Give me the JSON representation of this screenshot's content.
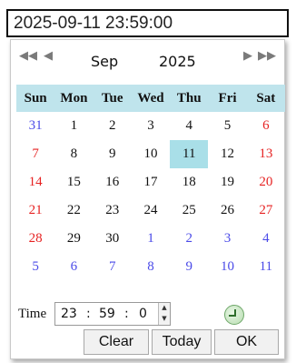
{
  "input": {
    "value": "2025-09-11 23:59:00"
  },
  "nav": {
    "prev_year_icon": "double-left-arrow",
    "prev_month_icon": "left-arrow",
    "next_month_icon": "right-arrow",
    "next_year_icon": "double-right-arrow",
    "month": "Sep",
    "year": "2025"
  },
  "calendar": {
    "weekdays": [
      "Sun",
      "Mon",
      "Tue",
      "Wed",
      "Thu",
      "Fri",
      "Sat"
    ],
    "weeks": [
      [
        {
          "d": "31",
          "t": "other"
        },
        {
          "d": "1",
          "t": ""
        },
        {
          "d": "2",
          "t": ""
        },
        {
          "d": "3",
          "t": ""
        },
        {
          "d": "4",
          "t": ""
        },
        {
          "d": "5",
          "t": ""
        },
        {
          "d": "6",
          "t": "wk"
        }
      ],
      [
        {
          "d": "7",
          "t": "wk"
        },
        {
          "d": "8",
          "t": ""
        },
        {
          "d": "9",
          "t": ""
        },
        {
          "d": "10",
          "t": ""
        },
        {
          "d": "11",
          "t": "sel"
        },
        {
          "d": "12",
          "t": ""
        },
        {
          "d": "13",
          "t": "wk"
        }
      ],
      [
        {
          "d": "14",
          "t": "wk"
        },
        {
          "d": "15",
          "t": ""
        },
        {
          "d": "16",
          "t": ""
        },
        {
          "d": "17",
          "t": ""
        },
        {
          "d": "18",
          "t": ""
        },
        {
          "d": "19",
          "t": ""
        },
        {
          "d": "20",
          "t": "wk"
        }
      ],
      [
        {
          "d": "21",
          "t": "wk"
        },
        {
          "d": "22",
          "t": ""
        },
        {
          "d": "23",
          "t": ""
        },
        {
          "d": "24",
          "t": ""
        },
        {
          "d": "25",
          "t": ""
        },
        {
          "d": "26",
          "t": ""
        },
        {
          "d": "27",
          "t": "wk"
        }
      ],
      [
        {
          "d": "28",
          "t": "wk"
        },
        {
          "d": "29",
          "t": ""
        },
        {
          "d": "30",
          "t": ""
        },
        {
          "d": "1",
          "t": "other"
        },
        {
          "d": "2",
          "t": "other"
        },
        {
          "d": "3",
          "t": "other"
        },
        {
          "d": "4",
          "t": "other"
        }
      ],
      [
        {
          "d": "5",
          "t": "other"
        },
        {
          "d": "6",
          "t": "other"
        },
        {
          "d": "7",
          "t": "other"
        },
        {
          "d": "8",
          "t": "other"
        },
        {
          "d": "9",
          "t": "other"
        },
        {
          "d": "10",
          "t": "other"
        },
        {
          "d": "11",
          "t": "other"
        }
      ]
    ],
    "selected_day": "11"
  },
  "time": {
    "label": "Time",
    "hour": "23",
    "minute": "59",
    "second": "0",
    "sep": ":"
  },
  "buttons": {
    "clear": "Clear",
    "today": "Today",
    "ok": "OK"
  },
  "colors": {
    "header_bg": "#bfe4ec",
    "selected_bg": "#a9dfe8",
    "weekend_text": "#e62222",
    "other_month_text": "#4a4ae8"
  },
  "icons": {
    "clock": "clock-icon",
    "spin_up": "spin-up-icon",
    "spin_down": "spin-down-icon"
  }
}
